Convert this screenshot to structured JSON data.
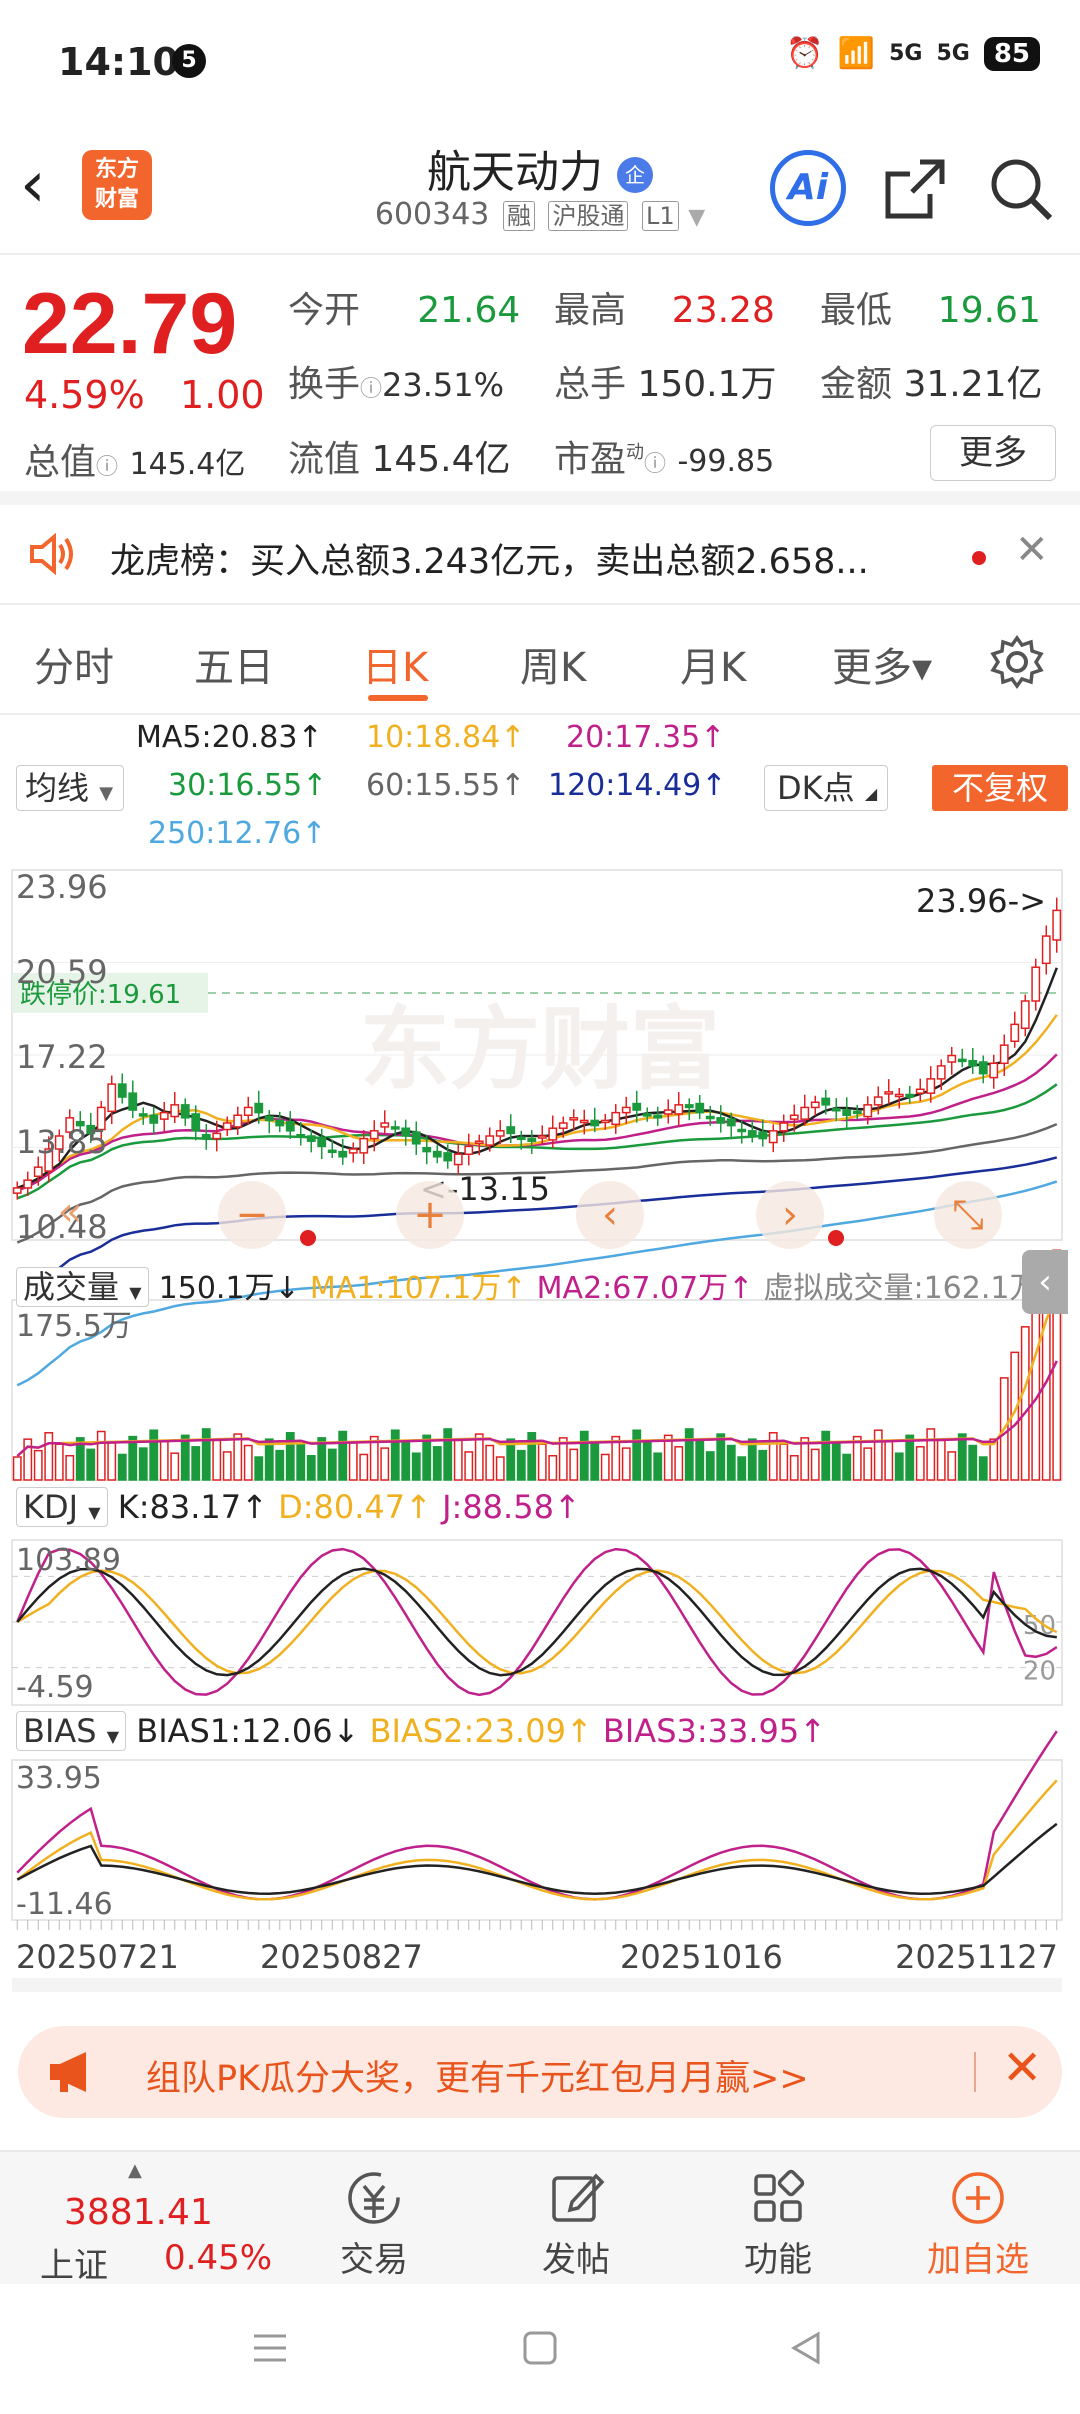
{
  "status": {
    "time": "14:10",
    "notif_count": "5",
    "battery": "85",
    "signal1": "5G",
    "signal2": "5G"
  },
  "header": {
    "stock_name": "航天动力",
    "badge": "企",
    "code": "600343",
    "tags": [
      "融",
      "沪股通",
      "L1"
    ],
    "logo_text_1": "东方",
    "logo_text_2": "财富",
    "ai_label": "Ai"
  },
  "quote": {
    "price": "22.79",
    "change_pct": "4.59%",
    "change_abs": "1.00",
    "open_label": "今开",
    "open": "21.64",
    "high_label": "最高",
    "high": "23.28",
    "low_label": "最低",
    "low": "19.61",
    "turnover_label": "换手",
    "turnover": "23.51%",
    "volume_label": "总手",
    "volume": "150.1万",
    "amount_label": "金额",
    "amount": "31.21亿",
    "mktcap_label": "总值",
    "mktcap": "145.4亿",
    "float_label": "流值",
    "float_cap": "145.4亿",
    "pe_label": "市盈",
    "pe_sup": "动",
    "pe": "-99.85",
    "more_label": "更多"
  },
  "dragon": {
    "text": "龙虎榜：买入总额3.243亿元，卖出总额2.658..."
  },
  "tabs": [
    {
      "label": "分时"
    },
    {
      "label": "五日"
    },
    {
      "label": "日K"
    },
    {
      "label": "周K"
    },
    {
      "label": "月K"
    },
    {
      "label": "更多▾"
    }
  ],
  "ma_legend": {
    "selector": "均线",
    "ma5": "MA5:20.83↑",
    "ma10": "10:18.84↑",
    "ma20": "20:17.35↑",
    "ma30": "30:16.55↑",
    "ma60": "60:15.55↑",
    "ma120": "120:14.49↑",
    "ma250": "250:12.76↑",
    "dk": "DK点",
    "fq": "不复权"
  },
  "kline": {
    "y_labels": [
      "23.96",
      "20.59",
      "17.22",
      "13.85",
      "10.48"
    ],
    "limit_down_label": "跌停价:19.61",
    "max_marker": "23.96->",
    "min_marker": "<-13.15",
    "watermark": "东方财富"
  },
  "volume": {
    "selector": "成交量",
    "value": "150.1万↓",
    "ma1": "MA1:107.1万↑",
    "ma2": "MA2:67.07万↑",
    "virtual": "虚拟成交量:162.1万",
    "y_max": "175.5万"
  },
  "kdj": {
    "selector": "KDJ",
    "k": "K:83.17↑",
    "d": "D:80.47↑",
    "j": "J:88.58↑",
    "y_top": "103.89",
    "y_bottom": "-4.59",
    "r50": "50",
    "r20": "20"
  },
  "bias": {
    "selector": "BIAS",
    "b1": "BIAS1:12.06↓",
    "b2": "BIAS2:23.09↑",
    "b3": "BIAS3:33.95↑",
    "y_top": "33.95",
    "y_bottom": "-11.46"
  },
  "dates": [
    "20250721",
    "20250827",
    "20251016",
    "20251127"
  ],
  "promo": {
    "text": "组队PK瓜分大奖，更有千元红包月月赢>>"
  },
  "bottom": {
    "index_value": "3881.41",
    "index_name": "上证",
    "index_chg": "0.45%",
    "trade": "交易",
    "post": "发帖",
    "func": "功能",
    "watch": "加自选"
  },
  "colors": {
    "up": "#e02020",
    "down": "#1a9a3c",
    "accent": "#f2652c"
  },
  "chart_data": {
    "type": "candlestick",
    "price_axis": [
      10.48,
      23.96
    ],
    "closes": [
      12.1,
      12.4,
      12.9,
      13.6,
      14.1,
      14.8,
      14.5,
      14.2,
      15.2,
      16.1,
      15.6,
      15.1,
      14.9,
      14.6,
      15.0,
      15.3,
      14.8,
      14.3,
      14.0,
      14.2,
      14.6,
      14.9,
      15.2,
      15.0,
      14.7,
      14.5,
      14.3,
      14.1,
      13.9,
      13.7,
      13.5,
      13.3,
      13.6,
      14.0,
      14.3,
      14.6,
      14.4,
      14.1,
      13.8,
      13.5,
      13.3,
      13.15,
      13.4,
      13.7,
      13.9,
      14.1,
      14.3,
      14.2,
      14.0,
      13.9,
      14.1,
      14.4,
      14.6,
      14.8,
      14.7,
      14.5,
      14.7,
      15.0,
      15.2,
      15.1,
      14.9,
      14.8,
      15.1,
      15.3,
      15.2,
      15.0,
      14.8,
      14.6,
      14.5,
      14.3,
      14.1,
      14.0,
      14.3,
      14.6,
      14.9,
      15.2,
      15.4,
      15.3,
      15.1,
      14.9,
      15.0,
      15.3,
      15.6,
      15.8,
      15.7,
      15.6,
      15.9,
      16.3,
      16.8,
      17.2,
      17.0,
      16.8,
      16.5,
      16.9,
      17.6,
      18.4,
      19.3,
      20.6,
      21.8,
      22.79
    ],
    "volume_max": 175.5,
    "kdj_range": [
      -4.59,
      103.89
    ],
    "bias_range": [
      -11.46,
      33.95
    ]
  }
}
